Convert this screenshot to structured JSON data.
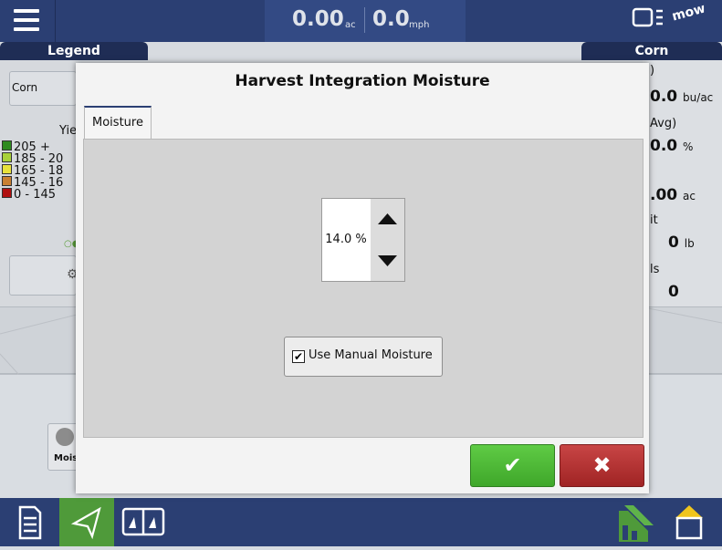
{
  "header": {
    "area_value": "0.00",
    "area_unit": "ac",
    "speed_value": "0.0",
    "speed_unit": "mph",
    "status_text": "mow"
  },
  "left_panel": {
    "tab_label": "Legend",
    "crop_button": "Corn",
    "legend_title": "Yie",
    "legend_items": [
      {
        "label": "205 +",
        "color": "#2e8b1f"
      },
      {
        "label": "185 - 20",
        "color": "#a8d13a"
      },
      {
        "label": "165 - 18",
        "color": "#e8e23b"
      },
      {
        "label": "145 - 16",
        "color": "#c98032"
      },
      {
        "label": "0 - 145",
        "color": "#b01010"
      }
    ],
    "lower_button_icon": "wrench-icon",
    "moisture_button_label": "Mois"
  },
  "right_panel": {
    "tab_label": "Corn",
    "fragment_1": ")",
    "yield_value": "0.0",
    "yield_unit": "bu/ac",
    "avg_label": "Avg)",
    "moisture_value": "0.0",
    "moisture_unit": "%",
    "area_value": ".00",
    "area_unit": "ac",
    "weight_label": "it",
    "weight_value": "0",
    "weight_unit": "lb",
    "loads_label": "ls",
    "loads_value": "0"
  },
  "dialog": {
    "title": "Harvest Integration Moisture",
    "tab_label": "Moisture",
    "moisture_value": "14.0 %",
    "manual_checkbox_label": "Use Manual Moisture",
    "manual_checked": true,
    "check_mark": "✔",
    "ok_symbol": "✔",
    "cancel_symbol": "✖"
  },
  "colors": {
    "nav_blue": "#2b3f73",
    "ok_green": "#4cb834",
    "cancel_red": "#b33232"
  }
}
